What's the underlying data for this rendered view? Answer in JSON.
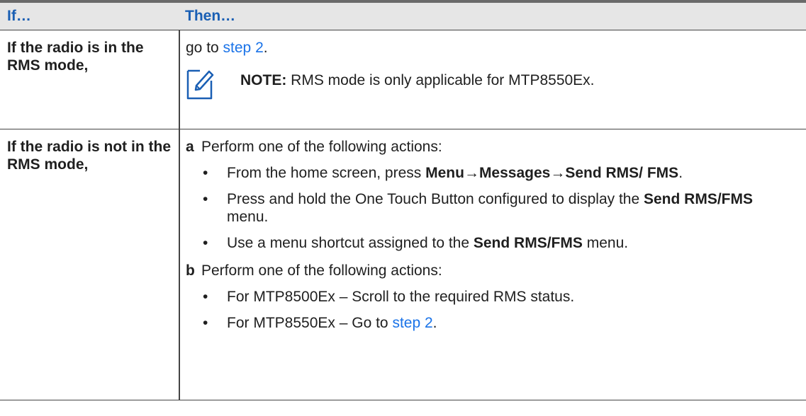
{
  "header": {
    "if_label": "If…",
    "then_label": "Then…"
  },
  "row1": {
    "condition": "If the radio is in the RMS mode,",
    "action_prefix": "go to ",
    "action_link": "step 2",
    "action_suffix": ".",
    "note_label": "NOTE:",
    "note_text": " RMS mode is only applicable for MTP8550Ex."
  },
  "row2": {
    "condition": "If the radio is not in the RMS mode,",
    "step_a": {
      "letter": "a",
      "text": "Perform one of the following actions:",
      "bullet1": {
        "pre": "From the home screen, press ",
        "b1": "Menu",
        "arrow1": "→",
        "b2": "Messages",
        "arrow2": "→",
        "b3": "Send RMS/ FMS",
        "post": "."
      },
      "bullet2": {
        "pre": "Press and hold the One Touch Button configured to display the ",
        "b1": "Send RMS/FMS",
        "post": " menu."
      },
      "bullet3": {
        "pre": "Use a menu shortcut assigned to the ",
        "b1": "Send RMS/FMS",
        "post": " menu."
      }
    },
    "step_b": {
      "letter": "b",
      "text": "Perform one of the following actions:",
      "bullet1": {
        "text": "For MTP8500Ex – Scroll to the required RMS status."
      },
      "bullet2": {
        "pre": "For MTP8550Ex – Go to ",
        "link": "step 2",
        "post": "."
      }
    },
    "bullet_char": "•"
  },
  "icons": {
    "note": "note-pencil-icon"
  },
  "colors": {
    "heading": "#1a5fb4",
    "link": "#1a73e8",
    "header_bg": "#e6e6e6"
  }
}
